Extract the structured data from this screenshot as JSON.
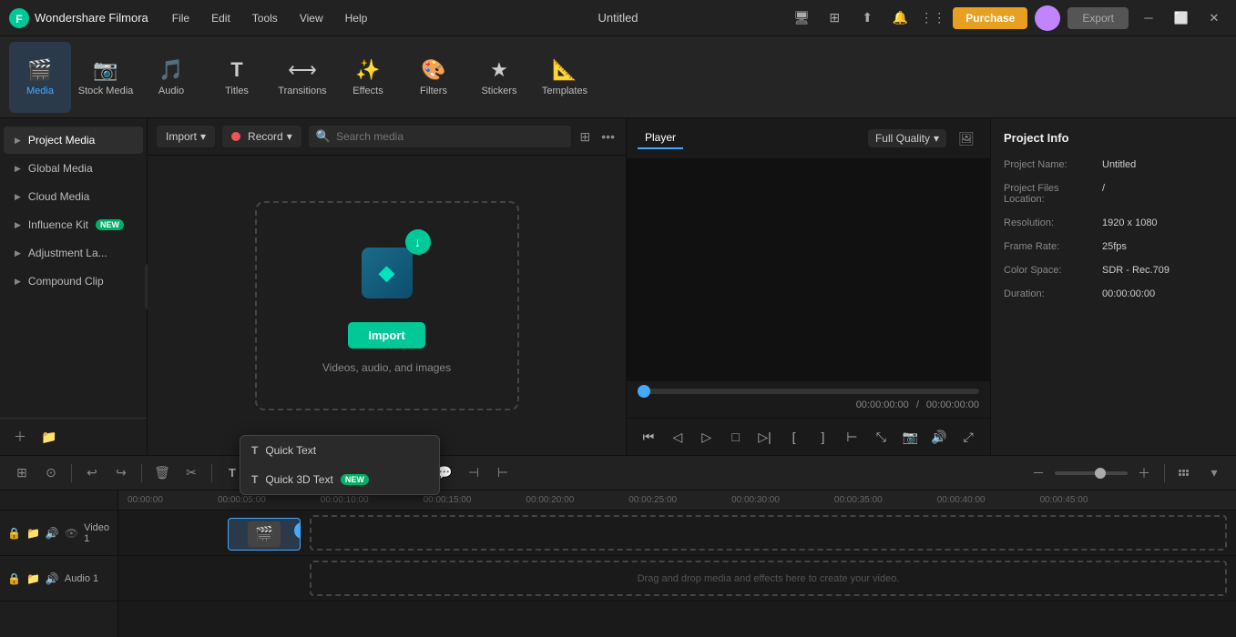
{
  "app": {
    "name": "Wondershare Filmora",
    "title": "Untitled"
  },
  "titlebar": {
    "menu": [
      "File",
      "Edit",
      "Tools",
      "View",
      "Help"
    ],
    "purchase_label": "Purchase",
    "export_label": "Export"
  },
  "toolbar": {
    "items": [
      {
        "id": "media",
        "label": "Media",
        "icon": "🎬"
      },
      {
        "id": "stock",
        "label": "Stock Media",
        "icon": "📷"
      },
      {
        "id": "audio",
        "label": "Audio",
        "icon": "🎵"
      },
      {
        "id": "titles",
        "label": "Titles",
        "icon": "T"
      },
      {
        "id": "transitions",
        "label": "Transitions",
        "icon": "⟷"
      },
      {
        "id": "effects",
        "label": "Effects",
        "icon": "✨"
      },
      {
        "id": "filters",
        "label": "Filters",
        "icon": "🎨"
      },
      {
        "id": "stickers",
        "label": "Stickers",
        "icon": "★"
      },
      {
        "id": "templates",
        "label": "Templates",
        "icon": "📐"
      }
    ]
  },
  "sidebar": {
    "items": [
      {
        "id": "project-media",
        "label": "Project Media",
        "active": true
      },
      {
        "id": "global-media",
        "label": "Global Media"
      },
      {
        "id": "cloud-media",
        "label": "Cloud Media"
      },
      {
        "id": "influence-kit",
        "label": "Influence Kit",
        "badge": "NEW"
      },
      {
        "id": "adjustment-la",
        "label": "Adjustment La..."
      },
      {
        "id": "compound-clip",
        "label": "Compound Clip"
      }
    ]
  },
  "media_toolbar": {
    "import_label": "Import",
    "record_label": "Record",
    "search_placeholder": "Search media"
  },
  "import_area": {
    "button_label": "Import",
    "hint": "Videos, audio, and images"
  },
  "preview": {
    "player_tab": "Player",
    "quality_label": "Full Quality",
    "time_current": "00:00:00:00",
    "time_total": "00:00:00:00"
  },
  "project_info": {
    "title": "Project Info",
    "fields": [
      {
        "label": "Project Name:",
        "value": "Untitled"
      },
      {
        "label": "Project Files Location:",
        "value": "/"
      },
      {
        "label": "Resolution:",
        "value": "1920 x 1080"
      },
      {
        "label": "Frame Rate:",
        "value": "25fps"
      },
      {
        "label": "Color Space:",
        "value": "SDR - Rec.709"
      },
      {
        "label": "Duration:",
        "value": "00:00:00:00"
      }
    ]
  },
  "timeline": {
    "ruler_marks": [
      "00:00:00",
      "00:00:05:00",
      "00:00:10:00",
      "00:00:15:00",
      "00:00:20:00",
      "00:00:25:00",
      "00:00:30:00",
      "00:00:35:00",
      "00:00:40:00",
      "00:00:45:00"
    ],
    "tracks": [
      {
        "label": "Video 1",
        "icon": "🎬"
      },
      {
        "label": "Audio 1",
        "icon": "🎵"
      }
    ],
    "drop_hint": "Drag and drop media and effects here to create your video."
  },
  "quick_text_dropdown": {
    "items": [
      {
        "label": "Quick Text"
      },
      {
        "label": "Quick 3D Text",
        "badge": "NEW"
      }
    ]
  }
}
